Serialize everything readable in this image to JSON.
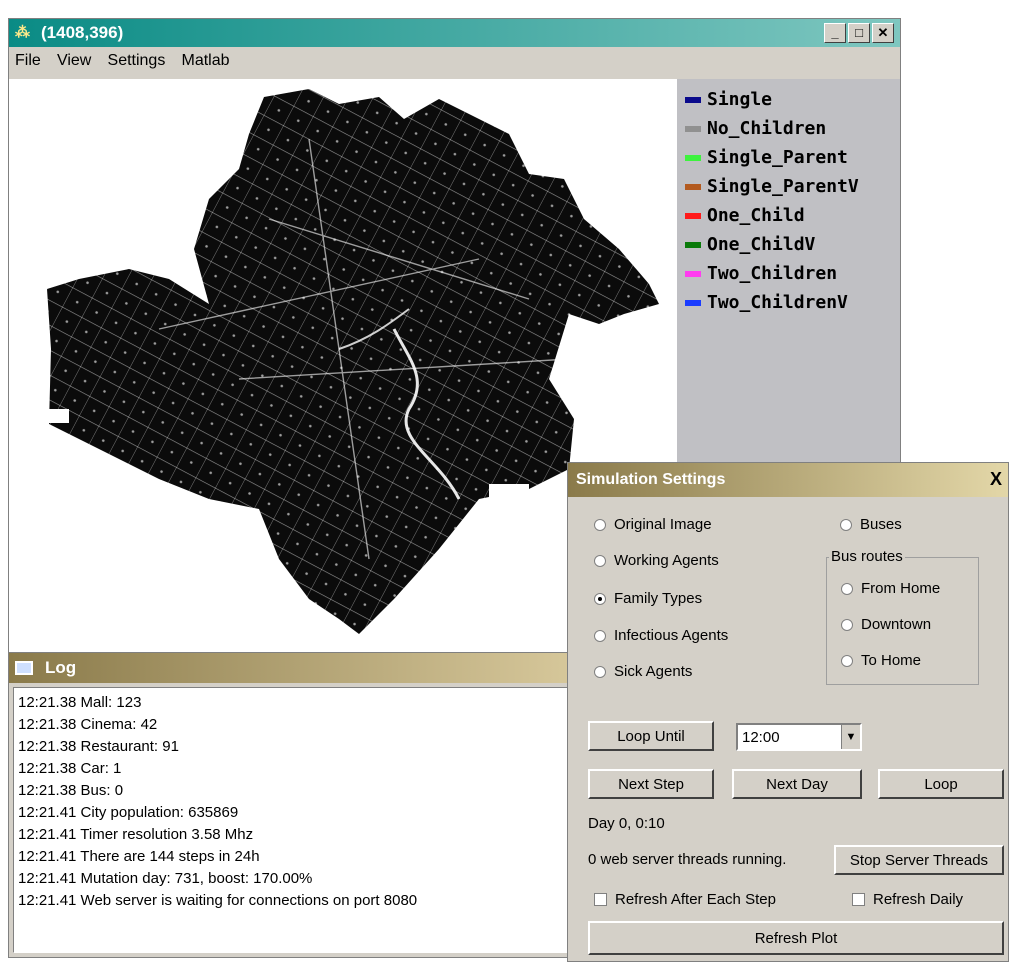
{
  "main_window": {
    "title": "(1408,396)",
    "menu": [
      "File",
      "View",
      "Settings",
      "Matlab"
    ],
    "window_buttons": {
      "minimize": "_",
      "maximize": "□",
      "close": "✕"
    }
  },
  "legend": {
    "items": [
      {
        "label": "Single",
        "color": "#0a0a8c"
      },
      {
        "label": "No_Children",
        "color": "#909090"
      },
      {
        "label": "Single_Parent",
        "color": "#3ef23e"
      },
      {
        "label": "Single_ParentV",
        "color": "#b35a1f"
      },
      {
        "label": "One_Child",
        "color": "#ff1a1a"
      },
      {
        "label": "One_ChildV",
        "color": "#0a7a0a"
      },
      {
        "label": "Two_Children",
        "color": "#ff3cf0"
      },
      {
        "label": "Two_ChildrenV",
        "color": "#1a3cff"
      }
    ]
  },
  "log": {
    "title": "Log",
    "lines": [
      "12:21.38 Mall: 123",
      "12:21.38 Cinema: 42",
      "12:21.38 Restaurant: 91",
      "12:21.38 Car: 1",
      "12:21.38 Bus: 0",
      "12:21.41 City population: 635869",
      "12:21.41 Timer resolution 3.58 Mhz",
      "12:21.41 There are 144 steps in 24h",
      "12:21.41 Mutation day: 731, boost: 170.00%",
      "12:21.41 Web server is waiting for connections on port 8080"
    ]
  },
  "settings": {
    "title": "Simulation Settings",
    "close": "X",
    "view_options": [
      {
        "label": "Original Image",
        "checked": false
      },
      {
        "label": "Working Agents",
        "checked": false
      },
      {
        "label": "Family Types",
        "checked": true
      },
      {
        "label": "Infectious Agents",
        "checked": false
      },
      {
        "label": "Sick Agents",
        "checked": false
      }
    ],
    "buses": {
      "label": "Buses",
      "checked": false
    },
    "bus_routes": {
      "label": "Bus routes",
      "options": [
        {
          "label": "From Home",
          "checked": false
        },
        {
          "label": "Downtown",
          "checked": false
        },
        {
          "label": "To Home",
          "checked": false
        }
      ]
    },
    "loop_until_label": "Loop Until",
    "loop_until_value": "12:00",
    "next_step_label": "Next Step",
    "next_day_label": "Next Day",
    "loop_label": "Loop",
    "day_status": "Day 0, 0:10",
    "threads_status": "0 web server threads running.",
    "stop_threads_label": "Stop Server Threads",
    "refresh_each_step": {
      "label": "Refresh After Each Step",
      "checked": false
    },
    "refresh_daily": {
      "label": "Refresh Daily",
      "checked": false
    },
    "refresh_plot_label": "Refresh Plot"
  }
}
